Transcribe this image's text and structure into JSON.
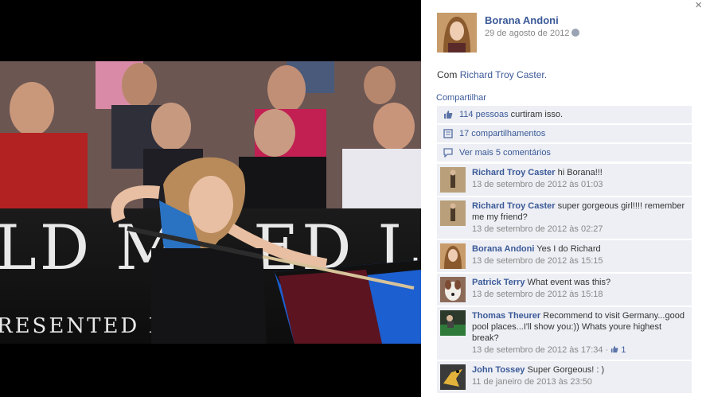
{
  "window": {
    "close_label": "×"
  },
  "post": {
    "author": "Borana Andoni",
    "date": "29 de agosto de 2012",
    "tag_prefix": "Com",
    "tagged": "Richard Troy Caster.",
    "share_label": "Compartilhar"
  },
  "photo": {
    "banner_text": "LD MA ED L",
    "banner_sub": "RESENTED BY  GS"
  },
  "ufi": {
    "likes": {
      "count": "114 pessoas",
      "suffix": "curtiram isso."
    },
    "shares": "17 compartilhamentos",
    "more_comments": "Ver mais 5 comentários"
  },
  "comments": [
    {
      "author": "Richard Troy Caster",
      "text": "hi Borana!!!",
      "time": "13 de setembro de 2012 às 01:03",
      "like": "",
      "avatar": "person-standing"
    },
    {
      "author": "Richard Troy Caster",
      "text": "super gorgeous girl!!!! remember me my friend?",
      "time": "13 de setembro de 2012 às 02:27",
      "like": "",
      "avatar": "person-standing"
    },
    {
      "author": "Borana Andoni",
      "text": "Yes I do Richard",
      "time": "13 de setembro de 2012 às 15:15",
      "like": "",
      "avatar": "woman"
    },
    {
      "author": "Patrick Terry",
      "text": "What event was this?",
      "time": "13 de setembro de 2012 às 15:18",
      "like": "",
      "avatar": "dog"
    },
    {
      "author": "Thomas Theurer",
      "text": "Recommend to visit Germany...good pool places...I'll show you:)) Whats youre highest break?",
      "time": "13 de setembro de 2012 às 17:34 · ",
      "like": "1",
      "avatar": "pool"
    },
    {
      "author": "John Tossey",
      "text": "Super Gorgeous! : )",
      "time": "11 de janeiro de 2013 às 23:50",
      "like": "",
      "avatar": "bird"
    }
  ]
}
